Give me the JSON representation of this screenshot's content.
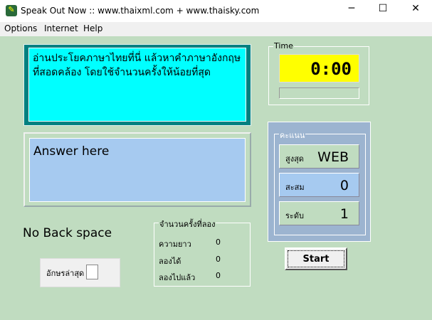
{
  "window": {
    "title": "Speak Out Now :: www.thaixml.com + www.thaisky.com",
    "minimize": "─",
    "maximize": "☐",
    "close": "✕"
  },
  "menu": [
    "Options",
    "Internet",
    "Help"
  ],
  "question": "อ่านประโยคภาษาไทยที่นี่ แล้วหาคำภาษาอังกฤษที่สอดคล้อง โดยใช้จำนวนครั้งให้น้อยที่สุด",
  "answer": "Answer here",
  "time": {
    "label": "Time",
    "value": "0:00",
    "progress": 0
  },
  "score": {
    "label": "คะแนน",
    "rows": [
      {
        "label": "สูงสุด",
        "value": "WEB"
      },
      {
        "label": "สะสม",
        "value": "0"
      },
      {
        "label": "ระดับ",
        "value": "1"
      }
    ]
  },
  "start_label": "Start",
  "no_backspace": "No Back space",
  "last_letter": {
    "label": "อักษรล่าสุด",
    "value": ""
  },
  "attempts": {
    "label": "จำนวนครั้งที่ลอง",
    "rows": [
      {
        "label": "ความยาว",
        "value": "0"
      },
      {
        "label": "ลองได้",
        "value": "0"
      },
      {
        "label": "ลองไปแล้ว",
        "value": "0"
      }
    ]
  }
}
